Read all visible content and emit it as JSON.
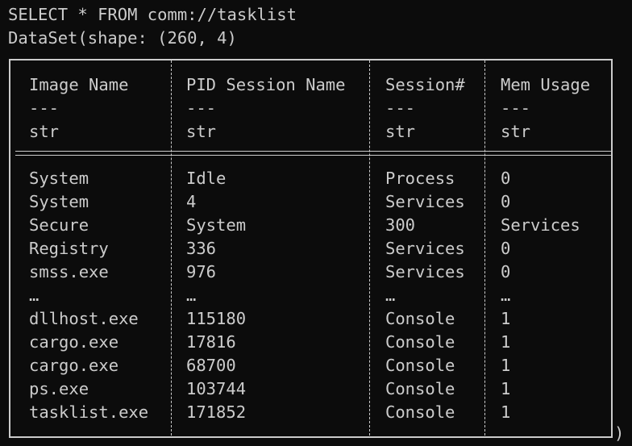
{
  "console": {
    "query": "SELECT * FROM comm://tasklist",
    "shape_line": "DataSet(shape: (260, 4)",
    "closing": ")"
  },
  "colors": {
    "background": "#0c0c0c",
    "text": "#cccccc",
    "accent": "#f9f1a5"
  },
  "table": {
    "columns": [
      {
        "name": "Image Name",
        "sep": "---",
        "dtype": "str"
      },
      {
        "name": "PID Session Name",
        "sep": "---",
        "dtype": "str"
      },
      {
        "name": "Session#",
        "sep": "---",
        "dtype": "str"
      },
      {
        "name": "Mem Usage",
        "sep": "---",
        "dtype": "str"
      }
    ],
    "rows": [
      [
        "System",
        "Idle",
        "Process",
        "0"
      ],
      [
        "System",
        "4",
        "Services",
        "0"
      ],
      [
        "Secure",
        "System",
        "300",
        "Services"
      ],
      [
        "Registry",
        "336",
        "Services",
        "0"
      ],
      [
        "smss.exe",
        "976",
        "Services",
        "0"
      ],
      [
        "…",
        "…",
        "…",
        "…"
      ],
      [
        "dllhost.exe",
        "115180",
        "Console",
        "1"
      ],
      [
        "cargo.exe",
        "17816",
        "Console",
        "1"
      ],
      [
        "cargo.exe",
        "68700",
        "Console",
        "1"
      ],
      [
        "ps.exe",
        "103744",
        "Console",
        "1"
      ],
      [
        "tasklist.exe",
        "171852",
        "Console",
        "1"
      ]
    ]
  }
}
